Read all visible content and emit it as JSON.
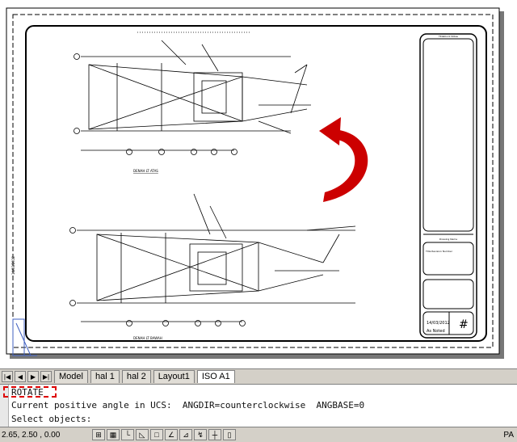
{
  "layout_tabs": [
    "Model",
    "hal 1",
    "hal 2",
    "Layout1",
    "ISO A1"
  ],
  "active_tab": "ISO A1",
  "command_line": {
    "lines": [
      "ROTATE",
      "Current positive angle in UCS:  ANGDIR=counterclockwise  ANGBASE=0",
      "Select objects:"
    ]
  },
  "status": {
    "coordinates": "2.65, 2.50 , 0.00",
    "buttons": [
      "snap-icon",
      "grid-icon",
      "ortho-icon",
      "polar-icon",
      "osnap-icon",
      "otrack-icon",
      "ducs-icon",
      "dyn-icon",
      "lwt-icon",
      "qp-icon"
    ],
    "right_label": "PA"
  },
  "drawing": {
    "title_block": {
      "top_label": "Titleblock Notes",
      "mid_label": "Drawing Name",
      "small_label": "Title Revision Number",
      "date": "14/03/2012",
      "by": "As Noted"
    },
    "view_labels": [
      "DENAH LT ATAS",
      "DENAH LT BAWAH"
    ],
    "arrow_color": "#cc0000"
  }
}
